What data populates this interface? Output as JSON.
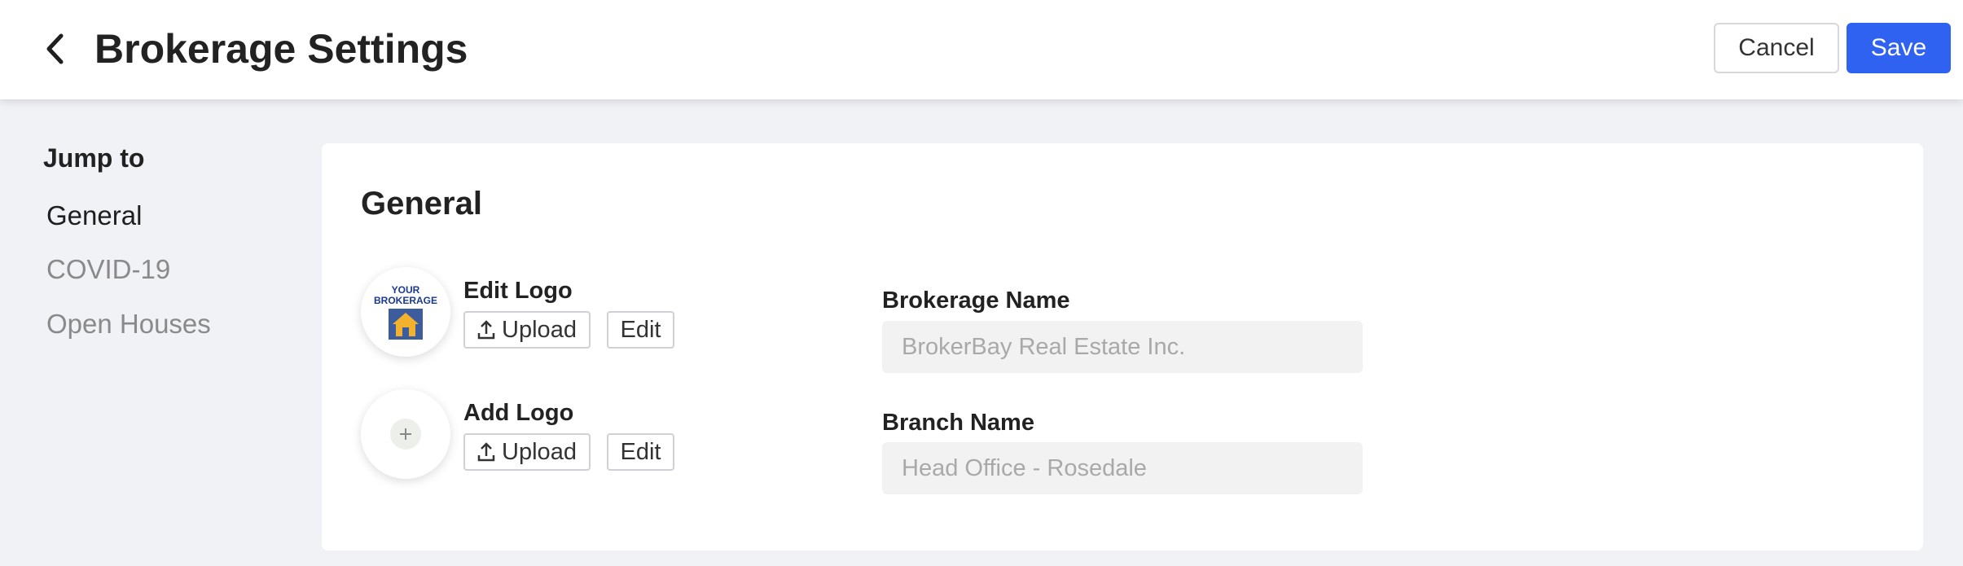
{
  "header": {
    "title": "Brokerage Settings",
    "cancel_label": "Cancel",
    "save_label": "Save"
  },
  "sidebar": {
    "heading": "Jump to",
    "items": [
      {
        "label": "General",
        "active": true
      },
      {
        "label": "COVID-19",
        "active": false
      },
      {
        "label": "Open Houses",
        "active": false
      }
    ]
  },
  "general": {
    "title": "General",
    "logos": [
      {
        "label": "Edit Logo",
        "logo_text": "YOUR BROKERAGE",
        "upload_label": "Upload",
        "edit_label": "Edit"
      },
      {
        "label": "Add Logo",
        "upload_label": "Upload",
        "edit_label": "Edit"
      }
    ],
    "fields": [
      {
        "label": "Brokerage Name",
        "placeholder": "BrokerBay Real Estate Inc."
      },
      {
        "label": "Branch Name",
        "placeholder": "Head Office - Rosedale"
      }
    ]
  },
  "icons": [
    "back-arrow-icon",
    "upload-icon",
    "plus-icon",
    "house-icon"
  ],
  "colors": {
    "primary": "#2f62f1",
    "page_bg": "#f1f2f6",
    "muted_text": "#8a8a8a",
    "input_bg": "#f2f2f2"
  }
}
